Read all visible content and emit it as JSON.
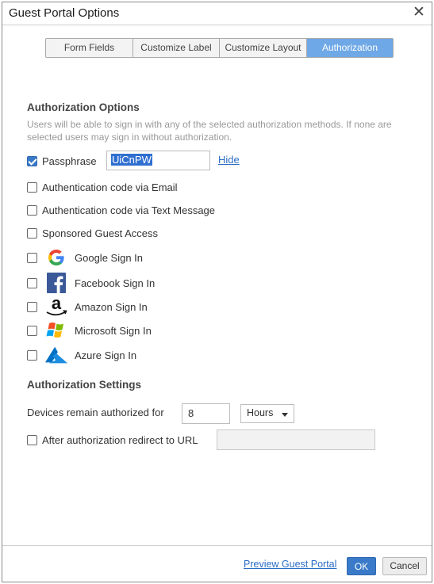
{
  "dialog": {
    "title": "Guest Portal Options",
    "close_glyph": "✕"
  },
  "tabs": [
    {
      "label": "Form Fields",
      "active": false
    },
    {
      "label": "Customize Label",
      "active": false
    },
    {
      "label": "Customize Layout",
      "active": false
    },
    {
      "label": "Authorization",
      "active": true
    }
  ],
  "auth_options": {
    "heading": "Authorization Options",
    "description": "Users will be able to sign in with any of the selected authorization methods. If none are selected users may sign in without authorization.",
    "passphrase": {
      "label": "Passphrase",
      "checked": true,
      "value": "UiCnPW",
      "hide_link": "Hide"
    },
    "methods": [
      {
        "label": "Authentication code via Email",
        "checked": false
      },
      {
        "label": "Authentication code via Text Message",
        "checked": false
      },
      {
        "label": "Sponsored Guest Access",
        "checked": false
      }
    ],
    "social": [
      {
        "label": "Google Sign In",
        "icon": "google-icon",
        "checked": false
      },
      {
        "label": "Facebook Sign In",
        "icon": "facebook-icon",
        "checked": false
      },
      {
        "label": "Amazon Sign In",
        "icon": "amazon-icon",
        "checked": false
      },
      {
        "label": "Microsoft Sign In",
        "icon": "microsoft-icon",
        "checked": false
      },
      {
        "label": "Azure Sign In",
        "icon": "azure-icon",
        "checked": false
      }
    ]
  },
  "auth_settings": {
    "heading": "Authorization Settings",
    "devices_label": "Devices remain authorized for",
    "devices_value": "8",
    "devices_unit": "Hours",
    "redirect_label": "After authorization redirect to URL",
    "redirect_checked": false,
    "redirect_value": ""
  },
  "footer": {
    "preview_link": "Preview Guest Portal",
    "ok_label": "OK",
    "cancel_label": "Cancel"
  },
  "colors": {
    "accent": "#3a7ac8",
    "active_tab": "#6fa8e6",
    "link": "#2b6cc4"
  }
}
